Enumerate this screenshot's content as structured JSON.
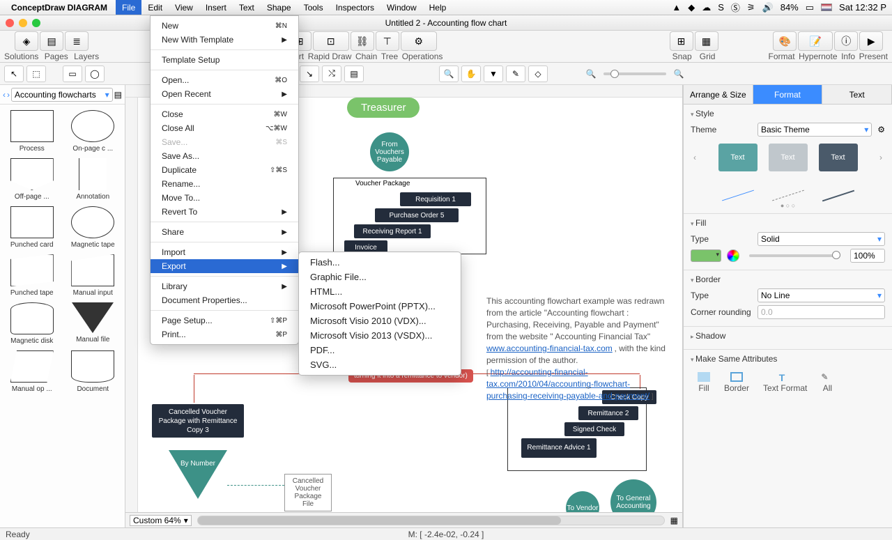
{
  "macmenu": {
    "app": "ConceptDraw DIAGRAM",
    "items": [
      "File",
      "Edit",
      "View",
      "Insert",
      "Text",
      "Shape",
      "Tools",
      "Inspectors",
      "Window",
      "Help"
    ],
    "active": "File",
    "right": {
      "battery": "84%",
      "clock": "Sat 12:32 P"
    }
  },
  "window": {
    "title": "Untitled 2 - Accounting flow chart"
  },
  "toolbar": {
    "groups": [
      {
        "labels": [
          "Solutions",
          "Pages",
          "Layers"
        ]
      },
      {
        "labels": [
          "Smart",
          "Rapid Draw",
          "Chain",
          "Tree",
          "Operations"
        ]
      },
      {
        "labels": [
          "Snap",
          "Grid"
        ]
      },
      {
        "labels": [
          "Format",
          "Hypernote",
          "Info",
          "Present"
        ]
      }
    ]
  },
  "leftpanel": {
    "libselect": "Accounting flowcharts",
    "shapes": [
      "Process",
      "On-page c ...",
      "Off-page  ...",
      "Annotation",
      "Punched card",
      "Magnetic tape",
      "Punched tape",
      "Manual input",
      "Magnetic disk",
      "Manual file",
      "Manual op ...",
      "Document"
    ]
  },
  "canvas": {
    "zoom": "Custom 64%",
    "pill": "Treasurer",
    "circle1": "From Vouchers Payable",
    "grouplabel": "Voucher Package",
    "boxes": [
      "Requisition 1",
      "Purchase Order 5",
      "Receiving Report 1",
      "Invoice"
    ],
    "redbox": "turning it into a remittance to vendor)",
    "cancel": "Cancelled Voucher Package with Remittance Copy 3",
    "tri1": "By Number",
    "file": "Cancelled Voucher Package File",
    "rboxes": [
      "Check Copy",
      "Remittance 2",
      "Signed Check",
      "Remittance Advice 1"
    ],
    "circ2": "To Vendor",
    "circ3": "To General Accounting",
    "note_text": "This accounting flowchart example was redrawn from the article \"Accounting flowchart : Purchasing, Receiving, Payable and Payment\" from the website \" Accounting Financial Tax\" ",
    "note_link1": "www.accounting-financial-tax.com",
    "note_text2": " , with the kind permission of the author.",
    "note_link2": "http://accounting-financial-tax.com/2010/04/accounting-flowchart-purchasing-receiving-payable-and-payment/"
  },
  "filemenu": {
    "items": [
      {
        "t": "New",
        "k": "⌘N"
      },
      {
        "t": "New With Template",
        "sub": true
      },
      {
        "sep": true
      },
      {
        "t": "Template Setup"
      },
      {
        "sep": true
      },
      {
        "t": "Open...",
        "k": "⌘O"
      },
      {
        "t": "Open Recent",
        "sub": true
      },
      {
        "sep": true
      },
      {
        "t": "Close",
        "k": "⌘W"
      },
      {
        "t": "Close All",
        "k": "⌥⌘W"
      },
      {
        "t": "Save...",
        "k": "⌘S",
        "dis": true
      },
      {
        "t": "Save As..."
      },
      {
        "t": "Duplicate",
        "k": "⇧⌘S"
      },
      {
        "t": "Rename..."
      },
      {
        "t": "Move To..."
      },
      {
        "t": "Revert To",
        "sub": true
      },
      {
        "sep": true
      },
      {
        "t": "Share",
        "sub": true
      },
      {
        "sep": true
      },
      {
        "t": "Import",
        "sub": true
      },
      {
        "t": "Export",
        "sub": true,
        "hi": true
      },
      {
        "sep": true
      },
      {
        "t": "Library",
        "sub": true
      },
      {
        "t": "Document Properties..."
      },
      {
        "sep": true
      },
      {
        "t": "Page Setup...",
        "k": "⇧⌘P"
      },
      {
        "t": "Print...",
        "k": "⌘P"
      }
    ],
    "export": [
      "Flash...",
      "Graphic File...",
      "HTML...",
      "Microsoft PowerPoint (PPTX)...",
      "Microsoft Visio 2010 (VDX)...",
      "Microsoft Visio 2013 (VSDX)...",
      "PDF...",
      "SVG..."
    ]
  },
  "inspector": {
    "tabs": [
      "Arrange & Size",
      "Format",
      "Text"
    ],
    "style": {
      "title": "Style",
      "theme_label": "Theme",
      "theme_value": "Basic Theme",
      "swatch": "Text"
    },
    "fill": {
      "title": "Fill",
      "type_label": "Type",
      "type_value": "Solid",
      "percent": "100%"
    },
    "border": {
      "title": "Border",
      "type_label": "Type",
      "type_value": "No Line",
      "corner_label": "Corner rounding",
      "corner_value": "0.0"
    },
    "shadow": {
      "title": "Shadow"
    },
    "make": {
      "title": "Make Same Attributes",
      "buttons": [
        "Fill",
        "Border",
        "Text Format",
        "All"
      ]
    }
  },
  "status": {
    "left": "Ready",
    "center": "M: [ -2.4e-02, -0.24 ]"
  }
}
